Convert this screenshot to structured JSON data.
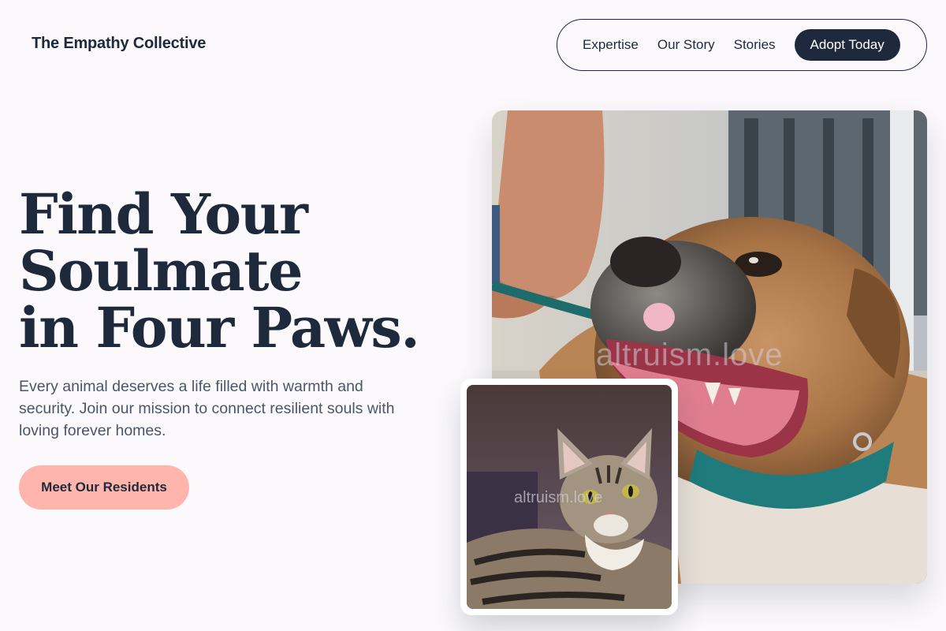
{
  "brand": {
    "name": "The Empathy Collective"
  },
  "nav": {
    "items": [
      "Expertise",
      "Our Story",
      "Stories"
    ],
    "cta_label": "Adopt Today"
  },
  "hero": {
    "headline_lines": [
      "Find Your",
      "Soulmate",
      "in Four Paws."
    ],
    "intro": "Every animal deserves a life filled with warmth and security. Join our mission to connect resilient souls with loving forever homes.",
    "primary_button": "Meet Our Residents"
  },
  "images": {
    "dog_watermark": "altruism.love",
    "cat_watermark": "altruism.love"
  },
  "colors": {
    "navy": "#1e2a3b",
    "accent_pink": "#ffb5ac",
    "background": "#fbf9fc",
    "body_text": "#4a5668"
  },
  "icons": [
    "dog-photo",
    "cat-photo"
  ]
}
